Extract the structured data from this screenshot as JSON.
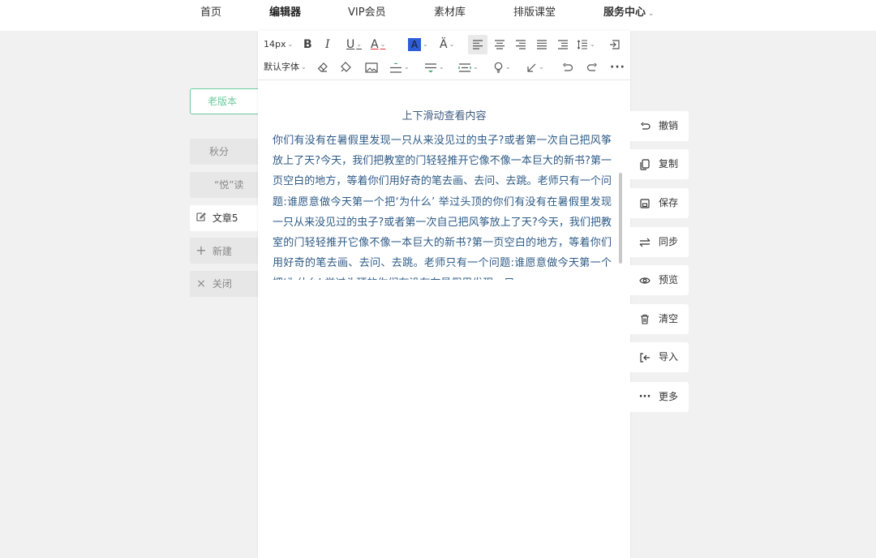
{
  "nav": {
    "items": [
      {
        "label": "首页"
      },
      {
        "label": "编辑器"
      },
      {
        "label": "VIP会员"
      },
      {
        "label": "素材库"
      },
      {
        "label": "排版课堂"
      },
      {
        "label": "服务中心"
      }
    ],
    "active": "编辑器"
  },
  "sidebar": {
    "old_version": "老版本",
    "articles": [
      {
        "label": "秋分"
      },
      {
        "label": "“悦”读"
      },
      {
        "label": "文章5"
      }
    ],
    "new_label": "新建",
    "close_label": "关闭"
  },
  "toolbar": {
    "font_size": "14px",
    "font_family": "默认字体",
    "more": "···"
  },
  "editor": {
    "title": "上下滑动查看内容",
    "body": "你们有没有在暑假里发现一只从来没见过的虫子?或者第一次自己把风筝放上了天?今天，我们把教室的门轻轻推开它像不像一本巨大的新书?第一页空白的地方，等着你们用好奇的笔去画、去问、去跳。老师只有一个问题:谁愿意做今天第一个把‘为什么’ 举过头顶的你们有没有在暑假里发现一只从来没见过的虫子?或者第一次自己把风筝放上了天?今天，我们把教室的门轻轻推开它像不像一本巨大的新书?第一页空白的地方，等着你们用好奇的笔去画、去问、去跳。老师只有一个问题:谁愿意做今天第一个把‘为什么’ 举过头顶的你们有没有在暑假里发现一只"
  },
  "actions": [
    {
      "label": "撤销",
      "icon": "undo-icon"
    },
    {
      "label": "复制",
      "icon": "copy-icon"
    },
    {
      "label": "保存",
      "icon": "save-icon"
    },
    {
      "label": "同步",
      "icon": "sync-icon"
    },
    {
      "label": "预览",
      "icon": "eye-icon"
    },
    {
      "label": "清空",
      "icon": "trash-icon"
    },
    {
      "label": "导入",
      "icon": "import-icon"
    },
    {
      "label": "更多",
      "icon": "more-icon"
    }
  ],
  "colors": {
    "accent": "#6cc99c",
    "content_text": "#2e5b86",
    "highlight_blue": "#2f5dd8"
  }
}
